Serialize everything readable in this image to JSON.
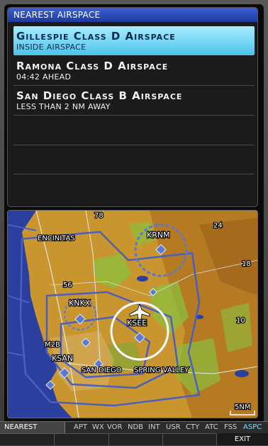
{
  "nearest_panel": {
    "title": "NEAREST AIRSPACE",
    "items": [
      {
        "name": "Gillespie Class D Airspace",
        "status": "INSIDE AIRSPACE",
        "selected": true
      },
      {
        "name": "Ramona Class D Airspace",
        "status": "04:42 AHEAD",
        "selected": false
      },
      {
        "name": "San Diego Class B Airspace",
        "status": "LESS THAN 2 NM AWAY",
        "selected": false
      }
    ]
  },
  "map": {
    "labels": {
      "encinitas": "ENCINITAS",
      "krnm": "KRNM",
      "knkx": "KNKX",
      "ksee": "KSEE",
      "ksan": "KSAN",
      "m2b": "M2B",
      "san_diego": "SAN DIEGO",
      "spring_valley": "SPRING VALLEY",
      "route_78": "78",
      "route_56": "56",
      "route_24": "24",
      "route_18": "18",
      "route_10": "10"
    },
    "scale": "5NM",
    "colors": {
      "land": "#c8952e",
      "water": "#2a3f9e",
      "vegetation": "#8cbf3f",
      "airspace_b": "#4a5fc0",
      "airspace_d": "#5a7ad0"
    }
  },
  "softkeys": {
    "page": "NEAREST",
    "items": [
      "APT",
      "WX",
      "VOR",
      "NDB",
      "INT",
      "USR",
      "CTY",
      "ATC",
      "FSS",
      "ASPC"
    ],
    "active": "ASPC",
    "exit": "EXIT"
  }
}
